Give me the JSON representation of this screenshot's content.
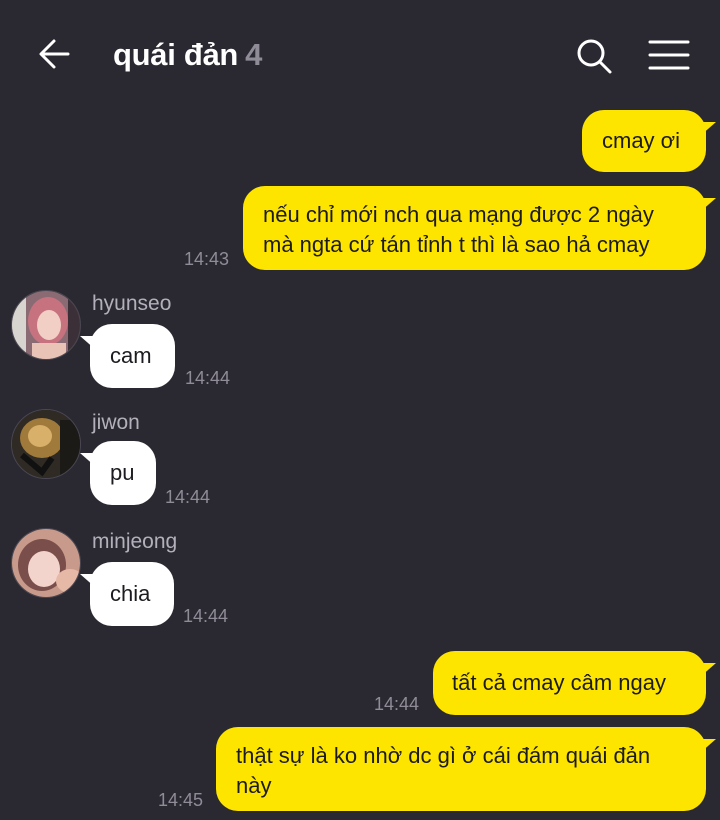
{
  "header": {
    "title": "quái đản",
    "member_count": "4",
    "back_icon": "arrow-left-icon",
    "search_icon": "search-icon",
    "menu_icon": "menu-icon"
  },
  "colors": {
    "background": "#2a2830",
    "outgoing_bubble": "#fee500",
    "incoming_bubble": "#ffffff",
    "timestamp": "#8f8c98"
  },
  "messages": [
    {
      "direction": "out",
      "text": "cmay ơi",
      "time": ""
    },
    {
      "direction": "out",
      "text": "nếu chỉ mới nch qua mạng được 2 ngày mà ngta cứ tán tỉnh t thì là sao hả cmay",
      "time": "14:43"
    },
    {
      "direction": "in",
      "sender": "hyunseo",
      "text": "cam",
      "time": "14:44"
    },
    {
      "direction": "in",
      "sender": "jiwon",
      "text": "pu",
      "time": "14:44"
    },
    {
      "direction": "in",
      "sender": "minjeong",
      "text": "chia",
      "time": "14:44"
    },
    {
      "direction": "out",
      "text": "tất cả cmay câm ngay",
      "time": "14:44"
    },
    {
      "direction": "out",
      "text": "thật sự là ko nhờ dc gì ở cái đám quái đản này",
      "time": "14:45"
    }
  ]
}
